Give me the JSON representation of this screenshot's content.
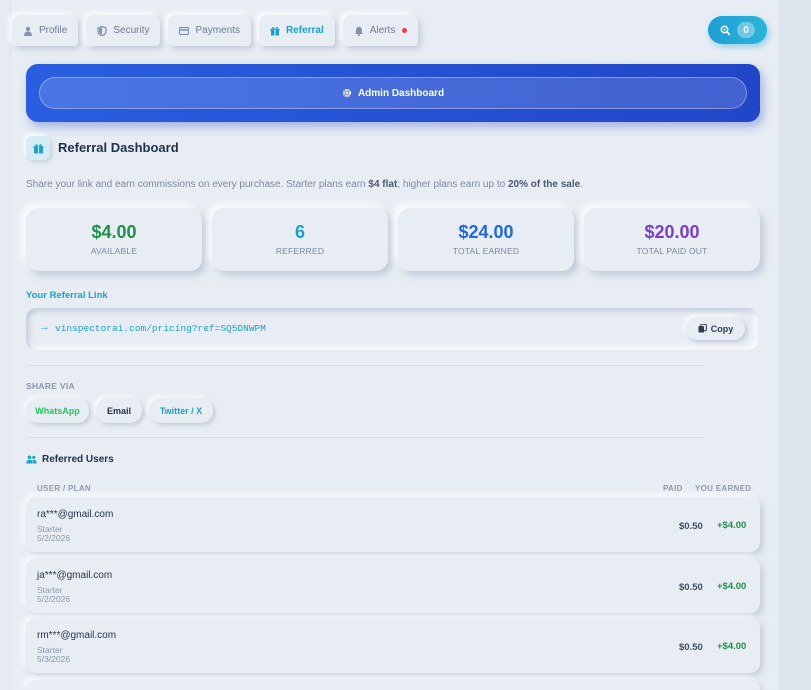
{
  "tabs": [
    {
      "label": "Profile",
      "icon": "user-icon",
      "active": false
    },
    {
      "label": "Security",
      "icon": "shield-icon",
      "active": false
    },
    {
      "label": "Payments",
      "icon": "credit-card-icon",
      "active": false
    },
    {
      "label": "Referral",
      "icon": "gift-icon",
      "active": true
    },
    {
      "label": "Alerts",
      "icon": "bell-icon",
      "active": false,
      "has_notification": true
    }
  ],
  "credits": {
    "icon": "search-icon",
    "count": "0"
  },
  "admin": {
    "label": "Admin Dashboard",
    "icon": "gear-icon"
  },
  "header": {
    "title": "Referral Dashboard",
    "icon": "gift-icon"
  },
  "description": {
    "part1": "Share your link and earn commissions on every purchase. Starter plans earn ",
    "bold1": "$4 flat",
    "part2": "; higher plans earn up to ",
    "bold2": "20% of the sale",
    "part3": "."
  },
  "stats": [
    {
      "value": "$4.00",
      "label": "AVAILABLE",
      "color": "#1f8f4e"
    },
    {
      "value": "6",
      "label": "REFERRED",
      "color": "#1aa1c9"
    },
    {
      "value": "$24.00",
      "label": "TOTAL EARNED",
      "color": "#2468d8"
    },
    {
      "value": "$20.00",
      "label": "TOTAL PAID OUT",
      "color": "#7b3fc4"
    }
  ],
  "referral_link": {
    "label": "Your Referral Link",
    "url": "vinspectorai.com/pricing?ref=SQ5DNWPM",
    "copy_label": "Copy"
  },
  "share": {
    "label": "SHARE VIA",
    "buttons": [
      {
        "label": "WhatsApp",
        "color": "#22c55e"
      },
      {
        "label": "Email",
        "color": "#1e3148"
      },
      {
        "label": "Twitter / X",
        "color": "#1aa1c9"
      }
    ]
  },
  "referred_users": {
    "title": "Referred Users",
    "columns": {
      "user": "USER / PLAN",
      "paid": "PAID",
      "earned": "YOU EARNED"
    },
    "rows": [
      {
        "email": "ra***@gmail.com",
        "plan": "Starter",
        "date": "5/2/2026",
        "paid": "$0.50",
        "earned": "+$4.00"
      },
      {
        "email": "ja***@gmail.com",
        "plan": "Starter",
        "date": "5/2/2026",
        "paid": "$0.50",
        "earned": "+$4.00"
      },
      {
        "email": "rm***@gmail.com",
        "plan": "Starter",
        "date": "5/3/2026",
        "paid": "$0.50",
        "earned": "+$4.00"
      }
    ]
  },
  "colors": {
    "accent": "#1aa1c9",
    "brand_blue": "#2146c7",
    "success": "#1f8f4e",
    "purple": "#7b3fc4"
  }
}
